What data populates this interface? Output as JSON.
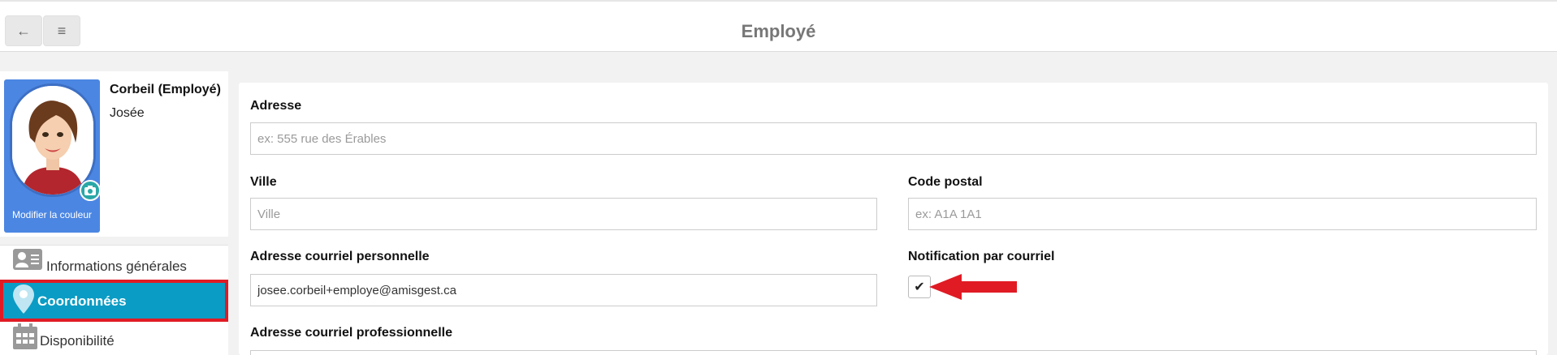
{
  "header": {
    "title": "Employé",
    "back_icon": "arrow-left-icon",
    "menu_icon": "hamburger-icon"
  },
  "profile": {
    "last_name": "Corbeil (Employé)",
    "first_name": "Josée",
    "change_color_label": "Modifier la couleur",
    "accent_color": "#4b86e2"
  },
  "sidebar": {
    "items": [
      {
        "label": "Informations générales",
        "icon": "id-card-icon",
        "active": false
      },
      {
        "label": "Coordonnées",
        "icon": "map-pin-icon",
        "active": true
      },
      {
        "label": "Disponibilité",
        "icon": "calendar-icon",
        "active": false
      }
    ],
    "active_color": "#0a9cc4",
    "highlight_color": "#e01b24"
  },
  "form": {
    "address": {
      "label": "Adresse",
      "value": "",
      "placeholder": "ex: 555 rue des Érables"
    },
    "city": {
      "label": "Ville",
      "value": "",
      "placeholder": "Ville"
    },
    "postal_code": {
      "label": "Code postal",
      "value": "",
      "placeholder": "ex: A1A 1A1"
    },
    "personal_email": {
      "label": "Adresse courriel personnelle",
      "value": "josee.corbeil+employe@amisgest.ca",
      "placeholder": ""
    },
    "email_notification": {
      "label": "Notification par courriel",
      "checked": true
    },
    "professional_email": {
      "label": "Adresse courriel professionnelle"
    }
  }
}
